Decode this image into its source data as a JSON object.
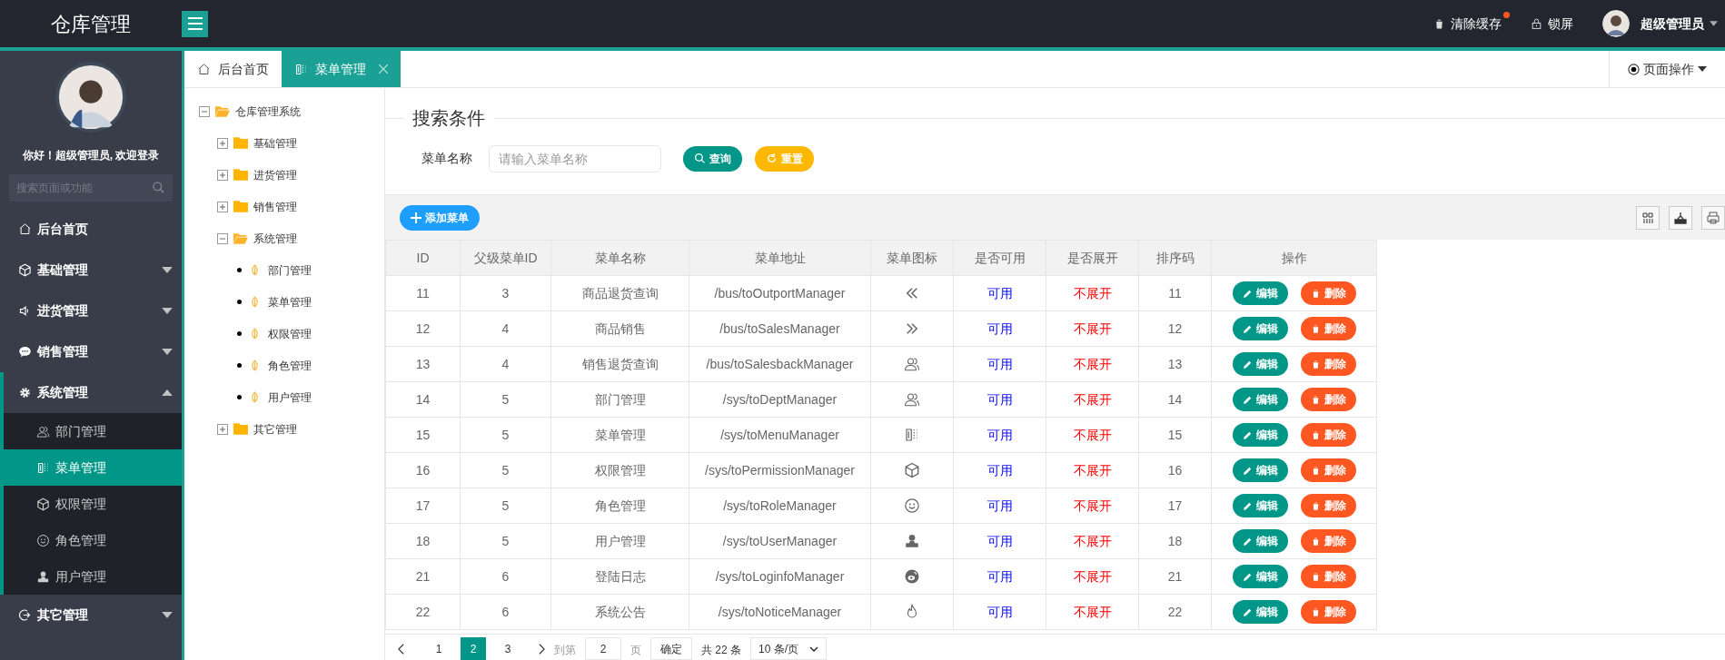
{
  "header": {
    "logo": "仓库管理",
    "actions": [
      {
        "kind": "trash",
        "label": "清除缓存",
        "badge": true
      },
      {
        "kind": "lock",
        "label": "锁屏",
        "badge": false
      }
    ],
    "user": {
      "name": "超级管理员"
    }
  },
  "sidebar": {
    "greeting": "你好！超级管理员, 欢迎登录",
    "search": {
      "placeholder": "搜索页面或功能"
    },
    "items": [
      {
        "kind": "home",
        "label": "后台首页"
      },
      {
        "kind": "cube",
        "label": "基础管理",
        "expanded": false
      },
      {
        "kind": "speaker",
        "label": "进货管理",
        "expanded": false
      },
      {
        "kind": "chat",
        "label": "销售管理",
        "expanded": false
      },
      {
        "kind": "gear",
        "label": "系统管理",
        "expanded": true,
        "children": [
          {
            "kind": "users",
            "label": "部门管理",
            "selected": false
          },
          {
            "kind": "menu",
            "label": "菜单管理",
            "selected": true
          },
          {
            "kind": "cube",
            "label": "权限管理",
            "selected": false
          },
          {
            "kind": "smile",
            "label": "角色管理",
            "selected": false
          },
          {
            "kind": "user",
            "label": "用户管理",
            "selected": false
          }
        ]
      },
      {
        "kind": "exit",
        "label": "其它管理",
        "expanded": false
      }
    ]
  },
  "tabs": [
    {
      "kind": "home",
      "label": "后台首页",
      "selected": false,
      "closable": false
    },
    {
      "kind": "menu",
      "label": "菜单管理",
      "selected": true,
      "closable": true
    }
  ],
  "page_actions": "页面操作",
  "tree": [
    {
      "label": "仓库管理系统",
      "expanded": true,
      "children": [
        {
          "label": "基础管理",
          "expanded": false
        },
        {
          "label": "进货管理",
          "expanded": false
        },
        {
          "label": "销售管理",
          "expanded": false
        },
        {
          "label": "系统管理",
          "expanded": true,
          "children": [
            {
              "label": "部门管理"
            },
            {
              "label": "菜单管理"
            },
            {
              "label": "权限管理"
            },
            {
              "label": "角色管理"
            },
            {
              "label": "用户管理"
            }
          ]
        },
        {
          "label": "其它管理",
          "expanded": false
        }
      ]
    }
  ],
  "search": {
    "title": "搜索条件",
    "label": "菜单名称",
    "placeholder": "请输入菜单名称",
    "buttons": [
      {
        "kind": "search",
        "label": "查询"
      },
      {
        "kind": "reset",
        "label": "重置"
      }
    ]
  },
  "toolbar": {
    "add": "添加菜单"
  },
  "table": {
    "columns": [
      "ID",
      "父级菜单ID",
      "菜单名称",
      "菜单地址",
      "菜单图标",
      "是否可用",
      "是否展开",
      "排序码",
      "操作"
    ],
    "rows": [
      {
        "id": "11",
        "parent": "3",
        "name": "商品退货查询",
        "url": "/bus/toOutportManager",
        "kind": "double-left",
        "available": "可用",
        "expand": "不展开",
        "order": "11",
        "actions": [
          "编辑",
          "删除"
        ]
      },
      {
        "id": "12",
        "parent": "4",
        "name": "商品销售",
        "url": "/bus/toSalesManager",
        "kind": "double-right",
        "available": "可用",
        "expand": "不展开",
        "order": "12",
        "actions": [
          "编辑",
          "删除"
        ]
      },
      {
        "id": "13",
        "parent": "4",
        "name": "销售退货查询",
        "url": "/bus/toSalesbackManager",
        "kind": "users",
        "available": "可用",
        "expand": "不展开",
        "order": "13",
        "actions": [
          "编辑",
          "删除"
        ]
      },
      {
        "id": "14",
        "parent": "5",
        "name": "部门管理",
        "url": "/sys/toDeptManager",
        "kind": "users",
        "available": "可用",
        "expand": "不展开",
        "order": "14",
        "actions": [
          "编辑",
          "删除"
        ]
      },
      {
        "id": "15",
        "parent": "5",
        "name": "菜单管理",
        "url": "/sys/toMenuManager",
        "kind": "menu",
        "available": "可用",
        "expand": "不展开",
        "order": "15",
        "actions": [
          "编辑",
          "删除"
        ]
      },
      {
        "id": "16",
        "parent": "5",
        "name": "权限管理",
        "url": "/sys/toPermissionManager",
        "kind": "cube",
        "available": "可用",
        "expand": "不展开",
        "order": "16",
        "actions": [
          "编辑",
          "删除"
        ]
      },
      {
        "id": "17",
        "parent": "5",
        "name": "角色管理",
        "url": "/sys/toRoleManager",
        "kind": "smile",
        "available": "可用",
        "expand": "不展开",
        "order": "17",
        "actions": [
          "编辑",
          "删除"
        ]
      },
      {
        "id": "18",
        "parent": "5",
        "name": "用户管理",
        "url": "/sys/toUserManager",
        "kind": "user",
        "available": "可用",
        "expand": "不展开",
        "order": "18",
        "actions": [
          "编辑",
          "删除"
        ]
      },
      {
        "id": "21",
        "parent": "6",
        "name": "登陆日志",
        "url": "/sys/toLoginfoManager",
        "kind": "weibo",
        "available": "可用",
        "expand": "不展开",
        "order": "21",
        "actions": [
          "编辑",
          "删除"
        ]
      },
      {
        "id": "22",
        "parent": "6",
        "name": "系统公告",
        "url": "/sys/toNoticeManager",
        "kind": "fire",
        "available": "可用",
        "expand": "不展开",
        "order": "22",
        "actions": [
          "编辑",
          "删除"
        ]
      }
    ]
  },
  "pagination": {
    "pages": [
      {
        "label": "1",
        "selected": false
      },
      {
        "label": "2",
        "selected": true
      },
      {
        "label": "3",
        "selected": false
      }
    ],
    "goto_label": "到第",
    "goto_value": "2",
    "page_unit": "页",
    "confirm": "确定",
    "total": "共 22 条",
    "page_size": "10 条/页"
  }
}
